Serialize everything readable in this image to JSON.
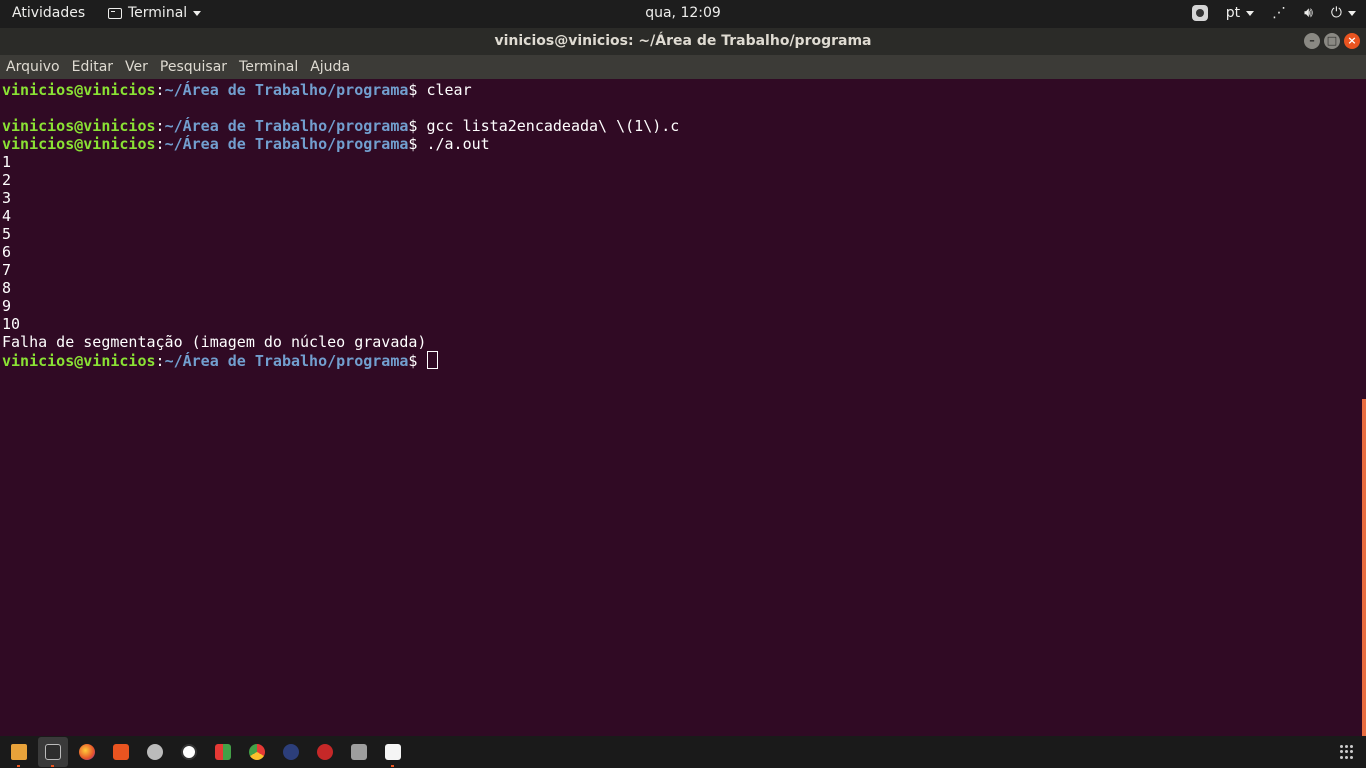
{
  "topbar": {
    "activities": "Atividades",
    "app_name": "Terminal",
    "clock": "qua, 12:09",
    "language": "pt"
  },
  "window": {
    "title": "vinicios@vinicios: ~/Área de Trabalho/programa"
  },
  "menu": {
    "items": [
      "Arquivo",
      "Editar",
      "Ver",
      "Pesquisar",
      "Terminal",
      "Ajuda"
    ]
  },
  "terminal": {
    "user": "vinicios@vinicios",
    "path": "~/Área de Trabalho/programa",
    "prompt_symbol": "$",
    "commands": [
      "clear",
      "gcc lista2encadeada\\ \\(1\\).c",
      "./a.out"
    ],
    "output": [
      "1",
      "2",
      "3",
      "4",
      "5",
      "6",
      "7",
      "8",
      "9",
      "10"
    ],
    "error": "Falha de segmentação (imagem do núcleo gravada)"
  },
  "dock": {
    "apps": [
      "files",
      "terminal",
      "firefox",
      "software-store",
      "settings",
      "android-studio",
      "blocks",
      "chrome",
      "eclipse",
      "ruby",
      "system-monitor",
      "text-editor"
    ]
  },
  "colors": {
    "terminal_bg": "#300a24",
    "user": "#8ae234",
    "path": "#729fcf",
    "accent": "#e95420"
  }
}
